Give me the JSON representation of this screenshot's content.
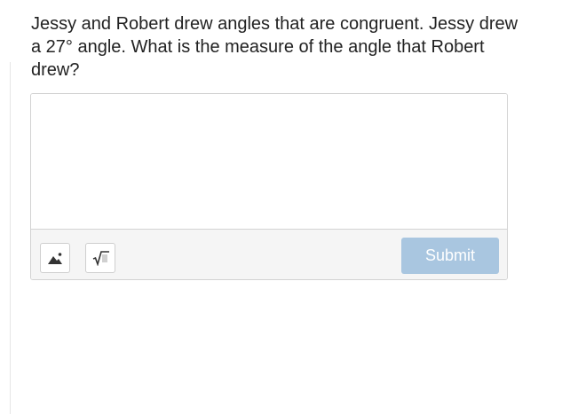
{
  "question": {
    "text": "Jessy and Robert drew angles that are congruent. Jessy drew a 27° angle. What is the measure of the angle that Robert drew?"
  },
  "answer": {
    "value": "",
    "placeholder": ""
  },
  "toolbar": {
    "image_icon": "image-icon",
    "math_icon": "square-root-icon",
    "submit_label": "Submit"
  },
  "colors": {
    "submit_disabled": "#a9c6e0",
    "toolbar_background": "#f5f5f5",
    "border": "#d3d3d3",
    "question_text": "#222222"
  }
}
